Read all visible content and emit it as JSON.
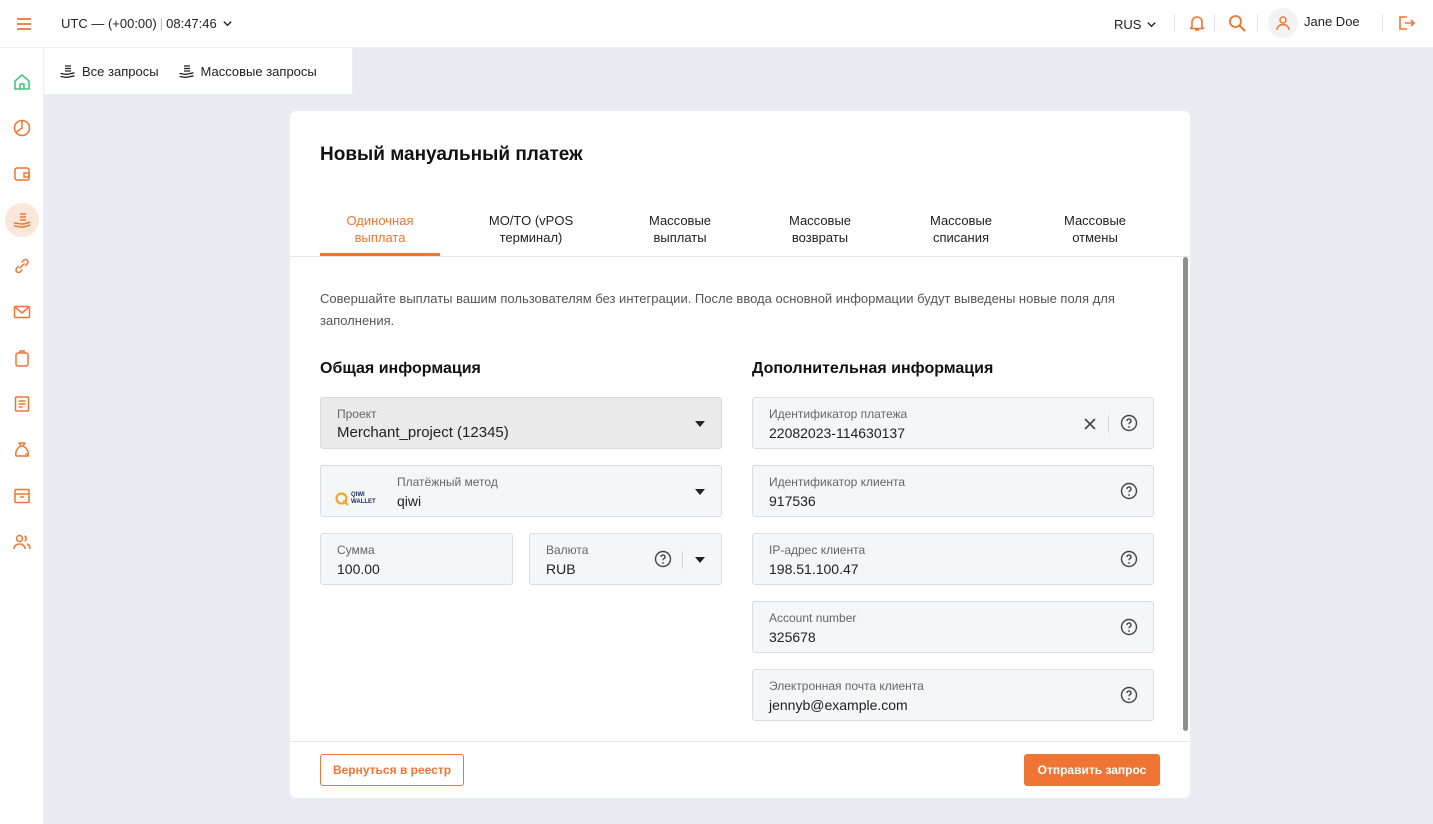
{
  "header": {
    "timezone": "UTC — (+00:00)",
    "separator": "|",
    "time": "08:47:46",
    "language": "RUS",
    "user_name": "Jane Doe",
    "icons": [
      "menu-icon",
      "chevron-down-icon",
      "bell-icon",
      "search-icon",
      "user-icon",
      "logout-icon"
    ],
    "accent_color": "#ee7534"
  },
  "sidebar": {
    "items": [
      {
        "icon": "home-icon",
        "active": false
      },
      {
        "icon": "pie-chart-icon",
        "active": false
      },
      {
        "icon": "wallet-icon",
        "active": false
      },
      {
        "icon": "payments-icon",
        "active": true
      },
      {
        "icon": "link-icon",
        "active": false
      },
      {
        "icon": "mail-icon",
        "active": false
      },
      {
        "icon": "clipboard-icon",
        "active": false
      },
      {
        "icon": "document-icon",
        "active": false
      },
      {
        "icon": "money-bag-icon",
        "active": false
      },
      {
        "icon": "archive-icon",
        "active": false
      },
      {
        "icon": "users-icon",
        "active": false
      }
    ]
  },
  "subnav": {
    "items": [
      {
        "label": "Все запросы",
        "icon": "coins-icon"
      },
      {
        "label": "Массовые запросы",
        "icon": "coins-icon"
      }
    ]
  },
  "card": {
    "title": "Новый мануальный платеж",
    "tabs": [
      {
        "line1": "Одиночная",
        "line2": "выплата",
        "active": true
      },
      {
        "line1": "MO/TO (vPOS",
        "line2": "терминал)",
        "active": false
      },
      {
        "line1": "Массовые",
        "line2": "выплаты",
        "active": false
      },
      {
        "line1": "Массовые",
        "line2": "возвраты",
        "active": false
      },
      {
        "line1": "Массовые",
        "line2": "списания",
        "active": false
      },
      {
        "line1": "Массовые",
        "line2": "отмены",
        "active": false
      }
    ],
    "description": "Совершайте выплаты вашим пользователям без интеграции. После ввода основной информации будут выведены новые поля для заполнения.",
    "general": {
      "title": "Общая информация",
      "project": {
        "label": "Проект",
        "value": "Merchant_project (12345)"
      },
      "method": {
        "label": "Платёжный метод",
        "value": "qiwi",
        "logo_line1": "QIWI",
        "logo_line2": "WALLET"
      },
      "amount": {
        "label": "Сумма",
        "value": "100.00"
      },
      "currency": {
        "label": "Валюта",
        "value": "RUB"
      }
    },
    "additional": {
      "title": "Дополнительная информация",
      "fields": [
        {
          "label": "Идентификатор платежа",
          "value": "22082023-114630137",
          "clearable": true
        },
        {
          "label": "Идентификатор клиента",
          "value": "917536",
          "clearable": false
        },
        {
          "label": "IP-адрес клиента",
          "value": "198.51.100.47",
          "clearable": false
        },
        {
          "label": "Account number",
          "value": "325678",
          "clearable": false
        },
        {
          "label": "Электронная почта клиента",
          "value": "jennyb@example.com",
          "clearable": false
        }
      ]
    },
    "buttons": {
      "back": "Вернуться в реестр",
      "send": "Отправить запрос"
    }
  }
}
